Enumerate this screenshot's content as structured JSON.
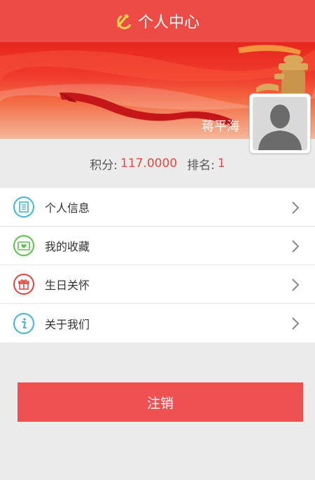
{
  "header": {
    "title": "个人中心",
    "icon": "party-emblem-icon"
  },
  "profile": {
    "username": "蒋平海",
    "avatar_icon": "default-avatar-icon"
  },
  "stats": {
    "points_label": "积分:",
    "points_value": "117.0000",
    "rank_label": "排名:",
    "rank_value": "1"
  },
  "menu": {
    "items": [
      {
        "label": "个人信息",
        "icon": "profile-info-icon",
        "color": "#3fb6d6"
      },
      {
        "label": "我的收藏",
        "icon": "favorites-icon",
        "color": "#5cc04a"
      },
      {
        "label": "生日关怀",
        "icon": "gift-icon",
        "color": "#e0453e"
      },
      {
        "label": "关于我们",
        "icon": "info-icon",
        "color": "#3fb6d6"
      }
    ]
  },
  "logout": {
    "label": "注销"
  },
  "colors": {
    "accent": "#ed4b45",
    "value": "#e8473f",
    "button": "#ef5151"
  }
}
